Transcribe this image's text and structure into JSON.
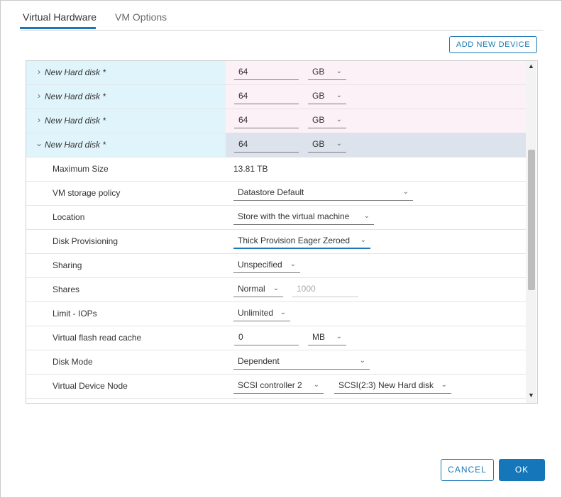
{
  "tabs": [
    {
      "label": "Virtual Hardware",
      "active": true
    },
    {
      "label": "VM Options",
      "active": false
    }
  ],
  "add_device_label": "ADD NEW DEVICE",
  "disks": [
    {
      "name": "New Hard disk *",
      "size": "64",
      "unit": "GB",
      "expanded": false
    },
    {
      "name": "New Hard disk *",
      "size": "64",
      "unit": "GB",
      "expanded": false
    },
    {
      "name": "New Hard disk *",
      "size": "64",
      "unit": "GB",
      "expanded": false
    },
    {
      "name": "New Hard disk *",
      "size": "64",
      "unit": "GB",
      "expanded": true
    }
  ],
  "details": {
    "max_size": {
      "label": "Maximum Size",
      "value": "13.81 TB"
    },
    "storage_policy": {
      "label": "VM storage policy",
      "value": "Datastore Default"
    },
    "location": {
      "label": "Location",
      "value": "Store with the virtual machine"
    },
    "provisioning": {
      "label": "Disk Provisioning",
      "value": "Thick Provision Eager Zeroed"
    },
    "sharing": {
      "label": "Sharing",
      "value": "Unspecified"
    },
    "shares": {
      "label": "Shares",
      "value": "Normal",
      "amount": "1000"
    },
    "limit_iops": {
      "label": "Limit - IOPs",
      "value": "Unlimited"
    },
    "flash_cache": {
      "label": "Virtual flash read cache",
      "value": "0",
      "unit": "MB"
    },
    "disk_mode": {
      "label": "Disk Mode",
      "value": "Dependent"
    },
    "device_node": {
      "label": "Virtual Device Node",
      "controller": "SCSI controller 2",
      "node": "SCSI(2:3) New Hard disk"
    }
  },
  "footer": {
    "cancel_label": "CANCEL",
    "ok_label": "OK"
  },
  "colors": {
    "accent": "#1b78b4",
    "disk_row_left": "#dff5fb",
    "disk_row_right": "#fbf1f6",
    "selected_row": "#dde3ec"
  }
}
